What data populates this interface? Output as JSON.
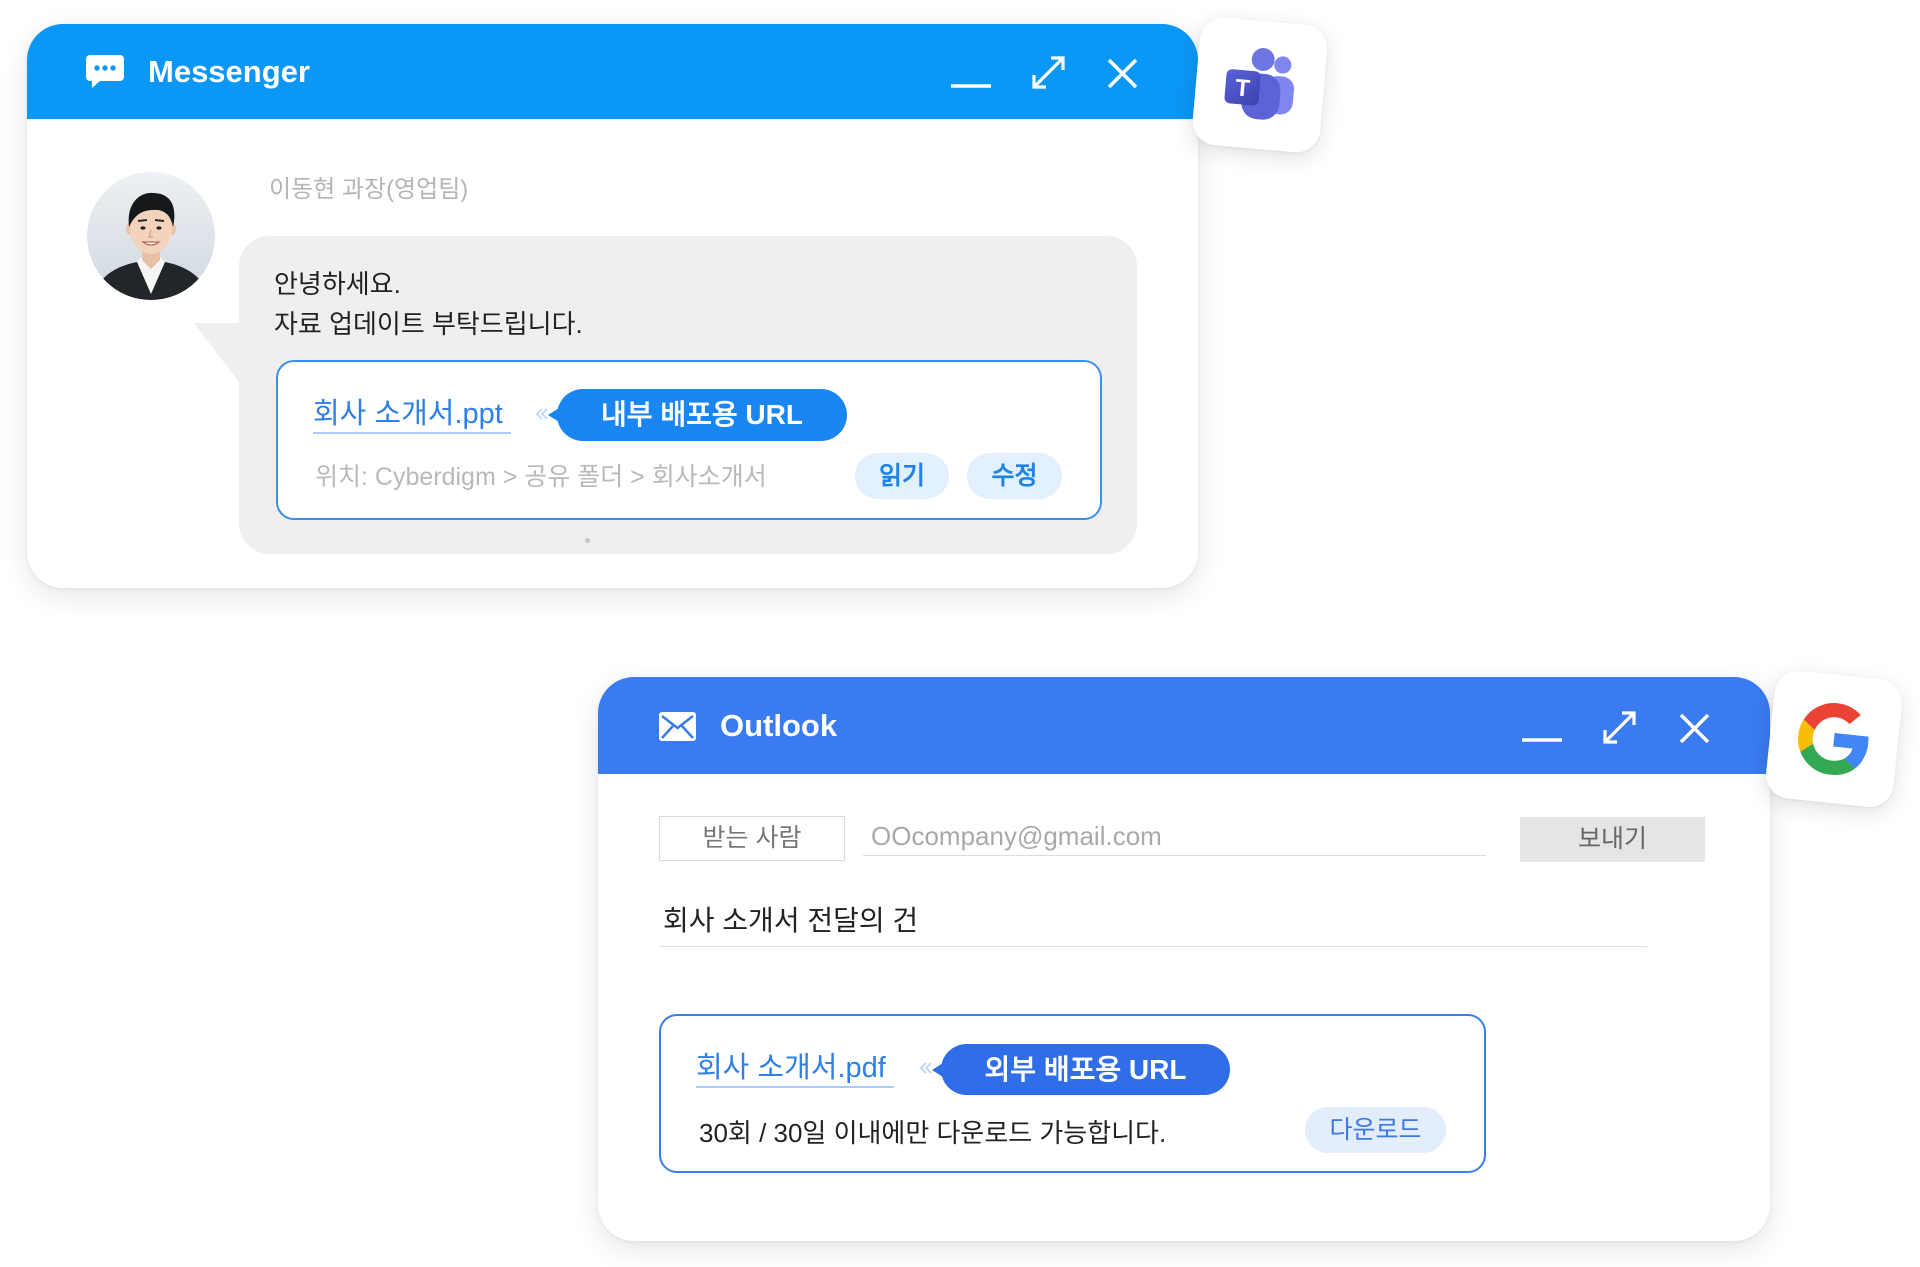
{
  "messenger": {
    "title": "Messenger",
    "title_icon": "chat-bubble-icon",
    "controls": {
      "minimize": "minimize-icon",
      "maximize": "maximize-icon",
      "close": "close-icon"
    },
    "message": {
      "sender": "이동현 과장(영업팀)",
      "lines": [
        "안녕하세요.",
        "자료 업데이트 부탁드립니다."
      ],
      "attachment": {
        "file_name": "회사 소개서.ppt",
        "badge": "내부 배포용 URL",
        "location": "위치: Cyberdigm > 공유 폴더 > 회사소개서",
        "actions": [
          "읽기",
          "수정"
        ]
      }
    }
  },
  "teams_badge": {
    "icon": "microsoft-teams-icon",
    "logo_letter": "T"
  },
  "outlook": {
    "title": "Outlook",
    "title_icon": "envelope-icon",
    "controls": {
      "minimize": "minimize-icon",
      "maximize": "maximize-icon",
      "close": "close-icon"
    },
    "compose": {
      "to_label": "받는 사람",
      "to_value": "OOcompany@gmail.com",
      "send_label": "보내기",
      "subject": "회사 소개서 전달의 건",
      "attachment": {
        "file_name": "회사 소개서.pdf",
        "badge": "외부 배포용 URL",
        "note": "30회 / 30일 이내에만 다운로드 가능합니다.",
        "action": "다운로드"
      }
    }
  },
  "google_badge": {
    "icon": "google-g-icon"
  },
  "colors": {
    "messenger_header": "#0b97f6",
    "outlook_header": "#3a7bf1",
    "link_blue": "#2e7fe6",
    "internal_badge": "#1a86f1",
    "external_badge": "#2f6ee8",
    "action_bg": "#e2f1fd",
    "card_border": "#3a8ff0"
  }
}
